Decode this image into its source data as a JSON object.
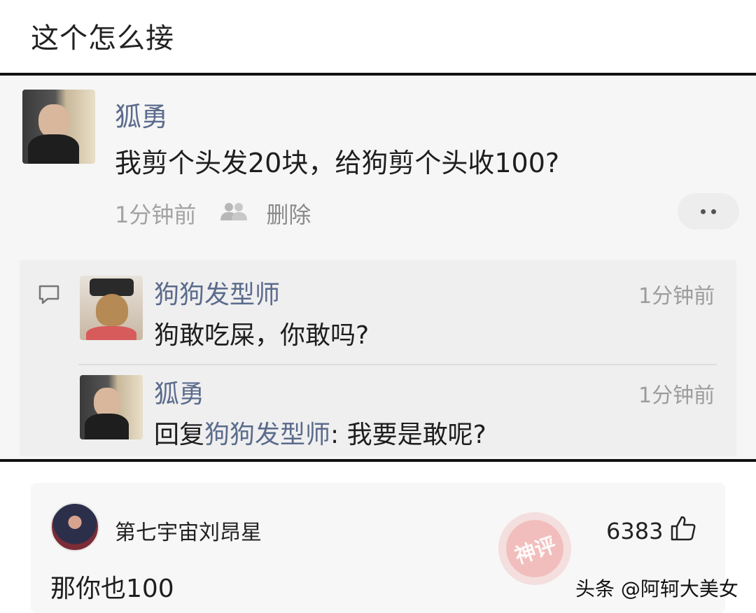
{
  "post": {
    "title": "这个怎么接"
  },
  "screenshot": {
    "comment": {
      "username": "狐勇",
      "text": "我剪个头发20块，给狗剪个头收100?",
      "time": "1分钟前",
      "delete_label": "删除"
    },
    "replies": [
      {
        "username": "狗狗发型师",
        "time": "1分钟前",
        "text": "狗敢吃屎，你敢吗?"
      },
      {
        "username": "狐勇",
        "time": "1分钟前",
        "reply_prefix": "回复",
        "mention": "狗狗发型师",
        "text": ": 我要是敢呢?"
      }
    ]
  },
  "top_comment": {
    "username": "第七宇宙刘昂星",
    "likes": "6383",
    "text": "那你也100",
    "stamp_text": "神评"
  },
  "watermark": "头条 @阿轲大美女",
  "colors": {
    "username": "#5b6b8c",
    "meta": "#a3a3a3",
    "stamp": "#e65050"
  },
  "icons": [
    "people-icon",
    "more-icon",
    "reply-bubble-icon",
    "thumbs-up-icon"
  ]
}
